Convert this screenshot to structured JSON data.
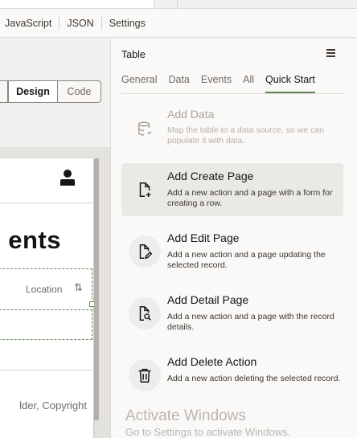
{
  "tabs": [
    "JavaScript",
    "JSON",
    "Settings"
  ],
  "toolbar": {
    "design_label": "Design",
    "code_label": "Code"
  },
  "canvas": {
    "title_fragment": "ents",
    "column_label": "Location",
    "footer_text": "lder, Copyright"
  },
  "panel": {
    "title": "Table",
    "tabs": [
      "General",
      "Data",
      "Events",
      "All",
      "Quick Start"
    ],
    "active_tab": "Quick Start",
    "items": [
      {
        "title": "Add Data",
        "desc": "Map the table to a data source, so we can populate it with data.",
        "icon": "database-icon",
        "enabled": false
      },
      {
        "title": "Add Create Page",
        "desc": "Add a new action and a page with a form for creating a row.",
        "icon": "page-add-icon",
        "enabled": true,
        "hover": true
      },
      {
        "title": "Add Edit Page",
        "desc": "Add a new action and a page updating the selected record.",
        "icon": "page-edit-icon",
        "enabled": true
      },
      {
        "title": "Add Detail Page",
        "desc": "Add a new action and a page with the record details.",
        "icon": "page-search-icon",
        "enabled": true
      },
      {
        "title": "Add Delete Action",
        "desc": "Add a new action deleting the selected record.",
        "icon": "trash-icon",
        "enabled": true
      }
    ]
  },
  "watermark": {
    "line1": "Activate Windows",
    "line2": "Go to Settings to activate Windows."
  },
  "colors": {
    "accent": "#5f8a57",
    "panel_bg": "#fbf9f8",
    "hover_bg": "#ebe9e6"
  }
}
